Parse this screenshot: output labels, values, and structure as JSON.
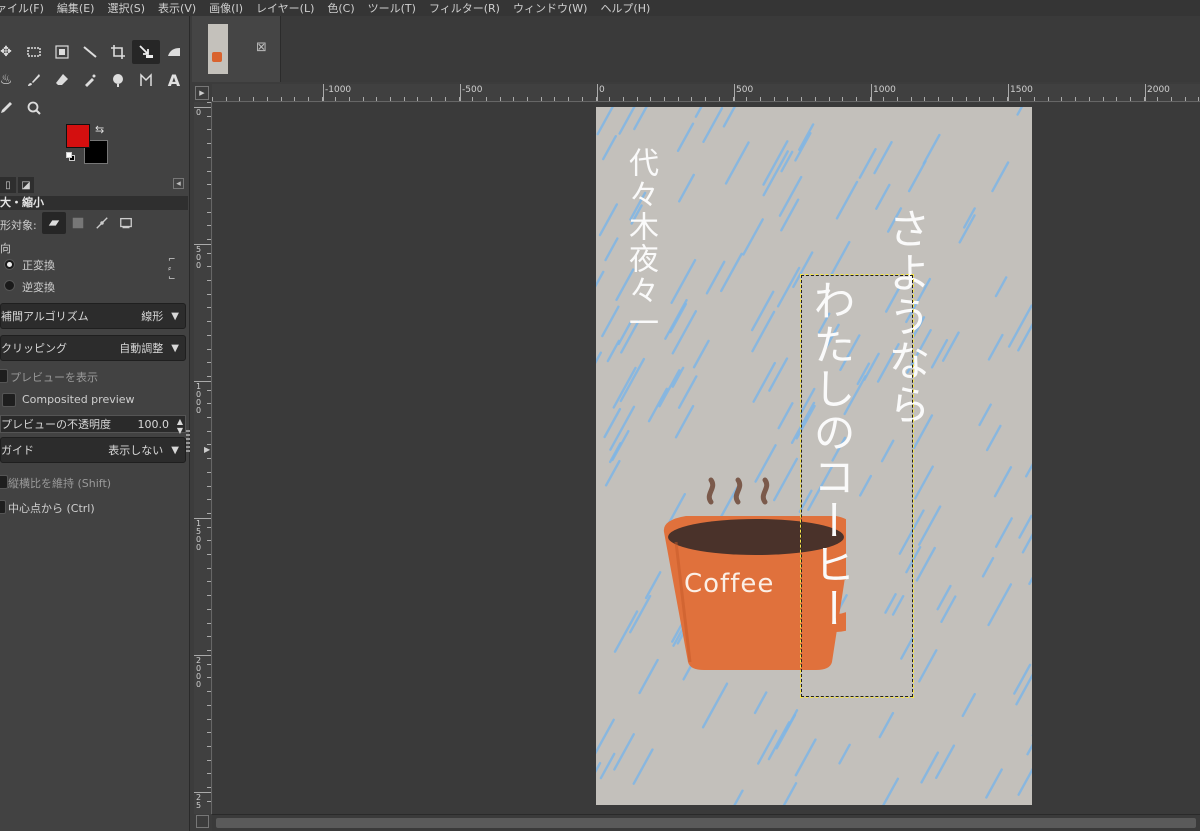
{
  "menu": [
    "ァイル(F)",
    "編集(E)",
    "選択(S)",
    "表示(V)",
    "画像(I)",
    "レイヤー(L)",
    "色(C)",
    "ツール(T)",
    "フィルター(R)",
    "ウィンドウ(W)",
    "ヘルプ(H)"
  ],
  "colors": {
    "foreground": "#d40f0f",
    "background": "#000000"
  },
  "tool_options": {
    "title": "大・縮小",
    "transform_label": "形対象:",
    "direction_label": "向",
    "direction_options": [
      "正変換",
      "逆変換"
    ],
    "interpolation_label": "補間アルゴリズム",
    "interpolation_value": "線形",
    "clipping_label": "クリッピング",
    "clipping_value": "自動調整",
    "show_preview": "プレビューを表示",
    "composited_preview": "Composited preview",
    "preview_opacity_label": "プレビューの不透明度",
    "preview_opacity_value": "100.0",
    "guides_label": "ガイド",
    "guides_value": "表示しない",
    "keep_aspect": "縦横比を維持 (Shift)",
    "from_center": "中心点から (Ctrl)"
  },
  "ruler": {
    "h_labels": [
      "-1000",
      "-500",
      "0",
      "500",
      "1000",
      "1500",
      "2000"
    ],
    "v_labels": [
      "0",
      "500",
      "1000",
      "1500",
      "2000",
      "25"
    ]
  },
  "artwork": {
    "author": "代々木夜々一",
    "title_line1": "さようなら",
    "title_line2": "わたしのコーヒー",
    "cup_label": "Coffee"
  }
}
